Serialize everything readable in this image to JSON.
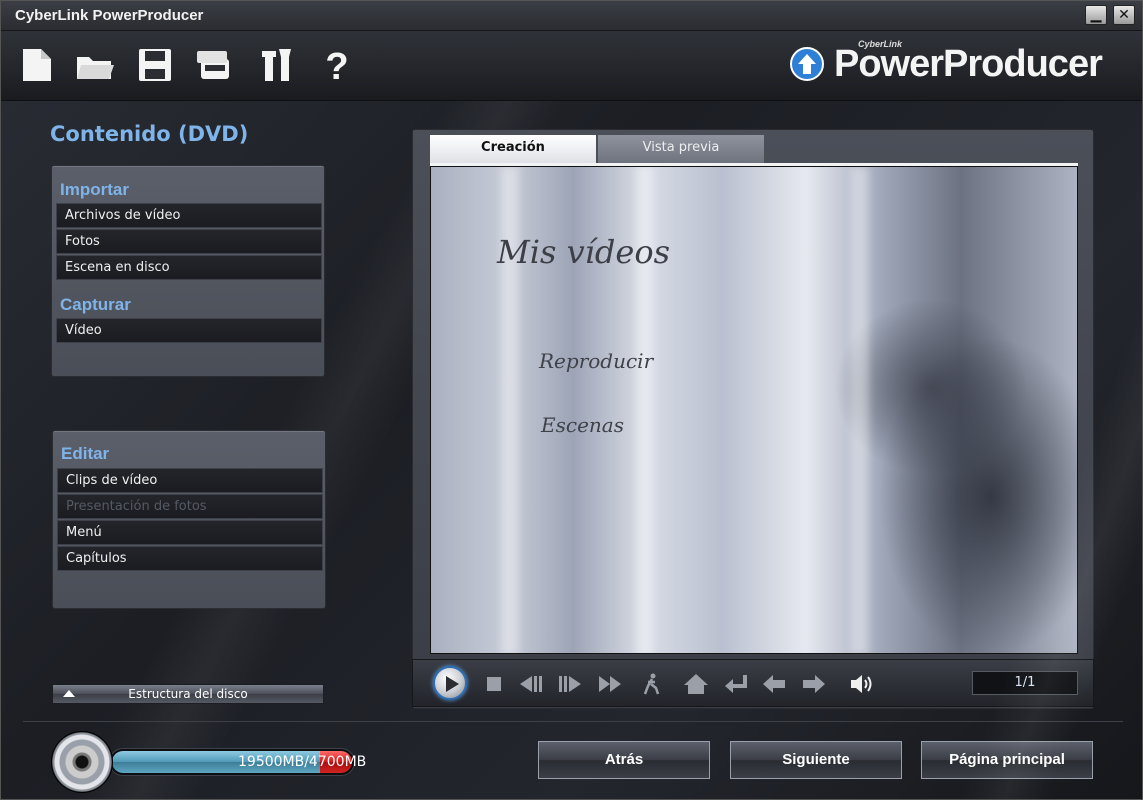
{
  "window": {
    "title": "CyberLink PowerProducer"
  },
  "toolbar": {
    "icons": [
      "new-file-icon",
      "open-folder-icon",
      "save-icon",
      "burn-disc-icon",
      "tools-icon",
      "help-icon"
    ]
  },
  "logo": {
    "sub": "CyberLink",
    "brand": "PowerProducer"
  },
  "content": {
    "title": "Contenido (DVD)",
    "import": {
      "heading": "Importar",
      "items": [
        "Archivos de vídeo",
        "Fotos",
        "Escena en disco"
      ]
    },
    "capture": {
      "heading": "Capturar",
      "items": [
        "Vídeo"
      ]
    },
    "edit": {
      "heading": "Editar",
      "items": [
        "Clips de vídeo",
        "Presentación de fotos",
        "Menú",
        "Capítulos"
      ],
      "disabled": [
        "Presentación de fotos"
      ]
    },
    "disc_structure": "Estructura del disco"
  },
  "preview": {
    "tabs": [
      "Creación",
      "Vista previa"
    ],
    "active_tab": "Creación",
    "menu_title": "Mis vídeos",
    "menu_options": [
      "Reproducir",
      "Escenas"
    ],
    "counter": "1/1"
  },
  "capacity": {
    "label": "19500MB/4700MB",
    "over_capacity": true
  },
  "nav": {
    "back": "Atrás",
    "next": "Siguiente",
    "home": "Página principal"
  },
  "colors": {
    "accent": "#7fb4ea",
    "capacity_bar": "#4f9ab8",
    "capacity_over": "#d31717"
  }
}
